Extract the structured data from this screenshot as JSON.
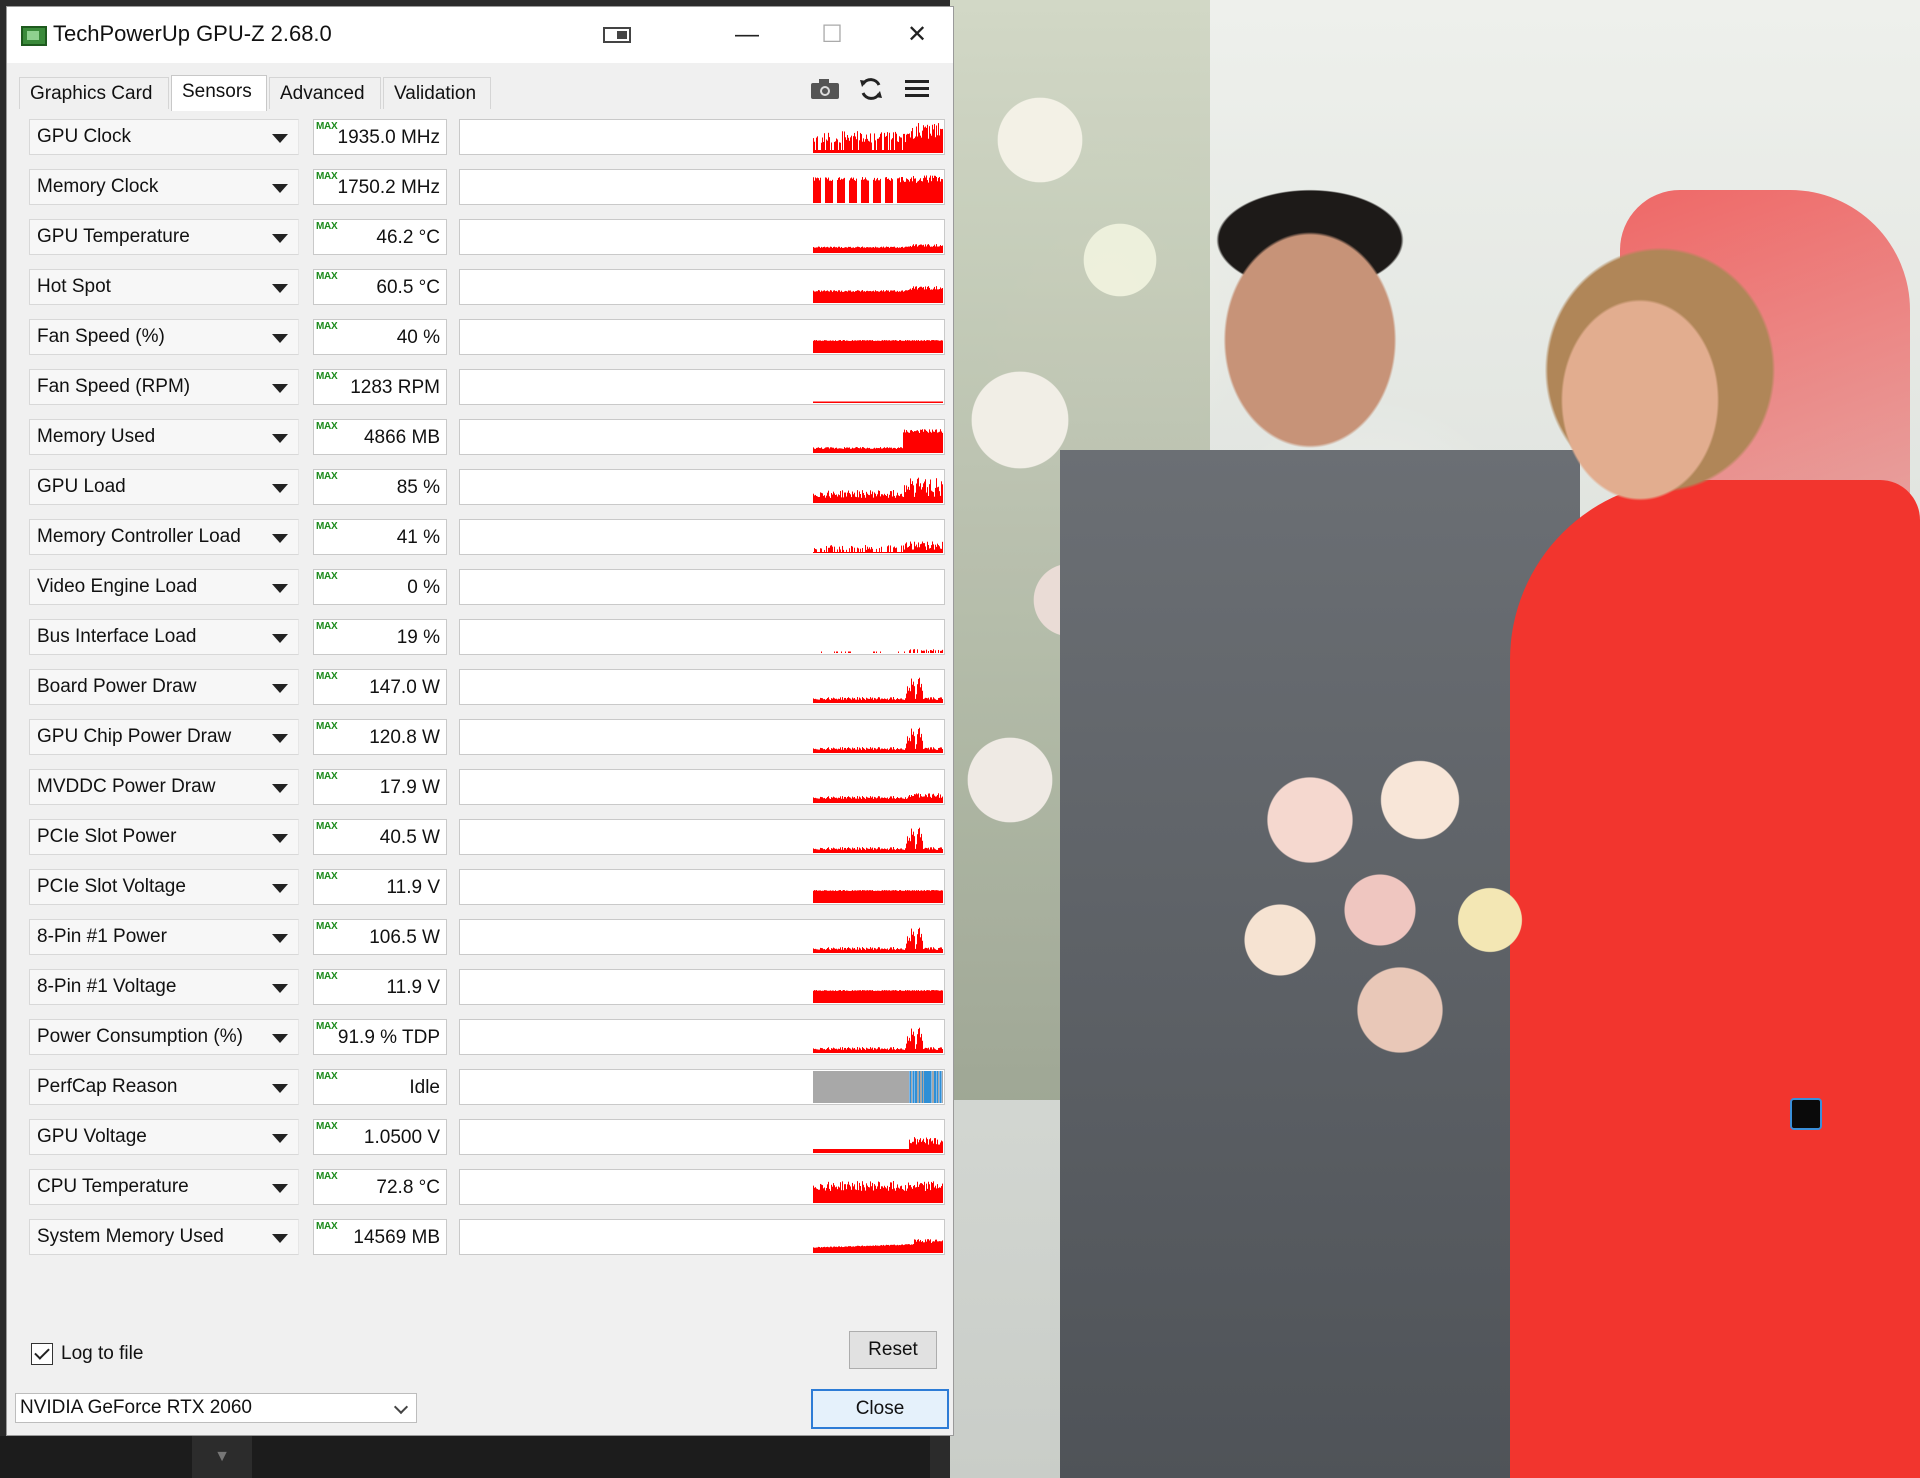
{
  "window": {
    "title": "TechPowerUp GPU-Z 2.68.0",
    "controls": {
      "minimize": "—",
      "maximize": "☐",
      "close": "✕"
    }
  },
  "tabs": [
    {
      "label": "Graphics Card",
      "active": false
    },
    {
      "label": "Sensors",
      "active": true
    },
    {
      "label": "Advanced",
      "active": false
    },
    {
      "label": "Validation",
      "active": false
    }
  ],
  "toolbar": {
    "icons": [
      "camera-icon",
      "refresh-icon",
      "menu-icon"
    ]
  },
  "max_label": "MAX",
  "sensors": [
    {
      "name": "GPU Clock",
      "value": "1935.0 MHz",
      "graph": "spiky-high",
      "color": "#ff0000"
    },
    {
      "name": "Memory Clock",
      "value": "1750.2 MHz",
      "graph": "blocks",
      "color": "#ff0000"
    },
    {
      "name": "GPU Temperature",
      "value": "46.2 °C",
      "graph": "low-flat",
      "color": "#ff0000"
    },
    {
      "name": "Hot Spot",
      "value": "60.5 °C",
      "graph": "mid-flat",
      "color": "#ff0000"
    },
    {
      "name": "Fan Speed (%)",
      "value": "40 %",
      "graph": "band",
      "color": "#ff0000"
    },
    {
      "name": "Fan Speed (RPM)",
      "value": "1283 RPM",
      "graph": "line",
      "color": "#ff0000"
    },
    {
      "name": "Memory Used",
      "value": "4866 MB",
      "graph": "step-up",
      "color": "#ff0000"
    },
    {
      "name": "GPU Load",
      "value": "85 %",
      "graph": "spiky-mid",
      "color": "#ff0000"
    },
    {
      "name": "Memory Controller Load",
      "value": "41 %",
      "graph": "spiky-low",
      "color": "#ff0000"
    },
    {
      "name": "Video Engine Load",
      "value": "0 %",
      "graph": "none",
      "color": "#ff0000"
    },
    {
      "name": "Bus Interface Load",
      "value": "19 %",
      "graph": "dots",
      "color": "#ff0000"
    },
    {
      "name": "Board Power Draw",
      "value": "147.0 W",
      "graph": "spike-end",
      "color": "#ff0000"
    },
    {
      "name": "GPU Chip Power Draw",
      "value": "120.8 W",
      "graph": "spike-end",
      "color": "#ff0000"
    },
    {
      "name": "MVDDC Power Draw",
      "value": "17.9 W",
      "graph": "low-noise",
      "color": "#ff0000"
    },
    {
      "name": "PCIe Slot Power",
      "value": "40.5 W",
      "graph": "spike-end",
      "color": "#ff0000"
    },
    {
      "name": "PCIe Slot Voltage",
      "value": "11.9 V",
      "graph": "band",
      "color": "#ff0000"
    },
    {
      "name": "8-Pin #1 Power",
      "value": "106.5 W",
      "graph": "spike-end",
      "color": "#ff0000"
    },
    {
      "name": "8-Pin #1 Voltage",
      "value": "11.9 V",
      "graph": "band",
      "color": "#ff0000"
    },
    {
      "name": "Power Consumption (%)",
      "value": "91.9 % TDP",
      "graph": "spike-end",
      "color": "#ff0000"
    },
    {
      "name": "PerfCap Reason",
      "value": "Idle",
      "graph": "perfcap",
      "color": "#a8a8a8"
    },
    {
      "name": "GPU Voltage",
      "value": "1.0500 V",
      "graph": "low-step",
      "color": "#ff0000"
    },
    {
      "name": "CPU Temperature",
      "value": "72.8 °C",
      "graph": "area-high",
      "color": "#ff0000"
    },
    {
      "name": "System Memory Used",
      "value": "14569 MB",
      "graph": "low-rise",
      "color": "#ff0000"
    }
  ],
  "footer": {
    "log_label": "Log to file",
    "log_checked": true,
    "reset_label": "Reset",
    "gpu_selected": "NVIDIA GeForce RTX 2060",
    "close_label": "Close"
  },
  "colors": {
    "graph": "#ff0000",
    "max_tag": "#1a8a1a",
    "perfcap_blue": "#2e8fd6",
    "focus": "#2d7cd6"
  }
}
